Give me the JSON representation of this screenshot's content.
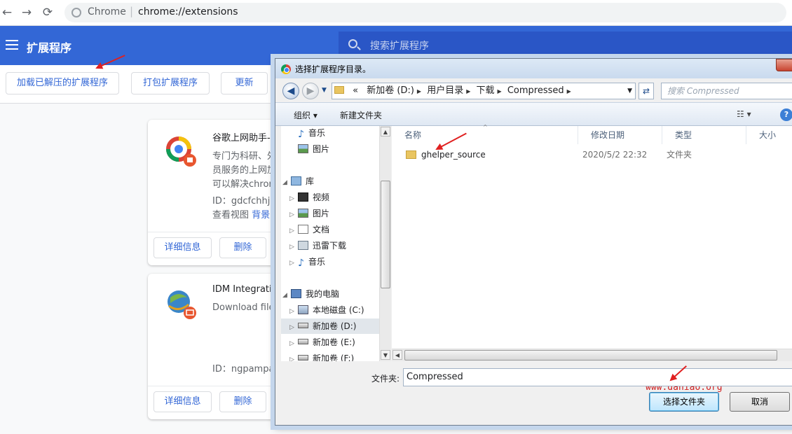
{
  "browser": {
    "site_label": "Chrome",
    "url_separator": "|",
    "url": "chrome://extensions",
    "back_icon": "←",
    "forward_icon": "→",
    "reload_icon": "⟳"
  },
  "header": {
    "title": "扩展程序",
    "search_placeholder": "搜索扩展程序",
    "accent": "#3367d6"
  },
  "toolbar": {
    "load_unpacked": "加载已解压的扩展程序",
    "pack": "打包扩展程序",
    "update": "更新"
  },
  "cards": [
    {
      "name": "谷歌上网助手-测",
      "desc_lines": [
        "专门为科研、外",
        "员服务的上网加",
        "可以解决chrom"
      ],
      "id_line": "ID：gdcfchhjllc",
      "view_label": "查看视图",
      "view_link": "背景页",
      "details": "详细信息",
      "remove": "删除"
    },
    {
      "name": "IDM Integration",
      "desc_lines": [
        "Download files"
      ],
      "id_line": "ID：ngpampap",
      "details": "详细信息",
      "remove": "删除"
    }
  ],
  "dialog": {
    "title": "选择扩展程序目录。",
    "breadcrumb": [
      "«",
      "新加卷 (D:)",
      "用户目录",
      "下载",
      "Compressed"
    ],
    "search_placeholder": "搜索 Compressed",
    "organize": "组织 ▾",
    "new_folder": "新建文件夹",
    "help": "?",
    "view_icon": "☷ ▾",
    "nav": [
      {
        "label": "音乐",
        "icon": "music",
        "level": 1
      },
      {
        "label": "图片",
        "icon": "pic",
        "level": 1
      },
      {
        "label": "库",
        "icon": "lib",
        "level": 0
      },
      {
        "label": "视频",
        "icon": "vid",
        "level": 1
      },
      {
        "label": "图片",
        "icon": "pic",
        "level": 1
      },
      {
        "label": "文档",
        "icon": "doc",
        "level": 1
      },
      {
        "label": "迅雷下载",
        "icon": "dl",
        "level": 1
      },
      {
        "label": "音乐",
        "icon": "music",
        "level": 1
      },
      {
        "label": "我的电脑",
        "icon": "pc",
        "level": 0
      },
      {
        "label": "本地磁盘 (C:)",
        "icon": "cdrive",
        "level": 1
      },
      {
        "label": "新加卷 (D:)",
        "icon": "drive",
        "level": 1,
        "selected": true
      },
      {
        "label": "新加卷 (E:)",
        "icon": "drive",
        "level": 1
      },
      {
        "label": "新加卷 (F:)",
        "icon": "drive",
        "level": 1
      }
    ],
    "columns": {
      "name": "名称",
      "date": "修改日期",
      "type": "类型",
      "size": "大小"
    },
    "files": [
      {
        "name": "ghelper_source",
        "date": "2020/5/2 22:32",
        "type": "文件夹"
      }
    ],
    "watermark": "www.daniao.org",
    "folder_label": "文件夹:",
    "folder_value": "Compressed",
    "select_btn": "选择文件夹",
    "cancel_btn": "取消"
  }
}
